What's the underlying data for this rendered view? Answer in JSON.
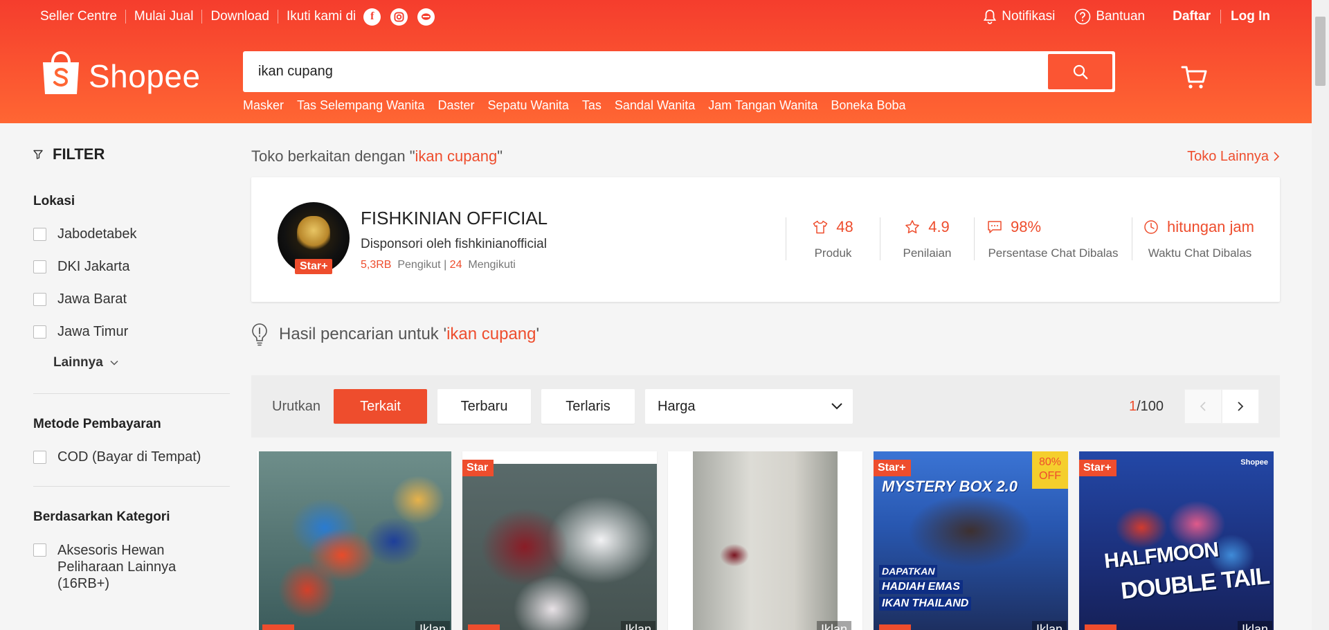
{
  "topnav": {
    "seller_centre": "Seller Centre",
    "mulai_jual": "Mulai Jual",
    "download": "Download",
    "ikuti": "Ikuti kami di",
    "notifikasi": "Notifikasi",
    "bantuan": "Bantuan",
    "daftar": "Daftar",
    "login": "Log In"
  },
  "brand": {
    "name": "Shopee",
    "color": "#ee4d2d"
  },
  "search": {
    "value": "ikan cupang",
    "suggestions": [
      "Masker",
      "Tas Selempang Wanita",
      "Daster",
      "Sepatu Wanita",
      "Tas",
      "Sandal Wanita",
      "Jam Tangan Wanita",
      "Boneka Boba"
    ]
  },
  "sidebar": {
    "filter_title": "FILTER",
    "lokasi": {
      "title": "Lokasi",
      "options": [
        "Jabodetabek",
        "DKI Jakarta",
        "Jawa Barat",
        "Jawa Timur"
      ],
      "more": "Lainnya"
    },
    "pembayaran": {
      "title": "Metode Pembayaran",
      "options": [
        "COD (Bayar di Tempat)"
      ]
    },
    "kategori": {
      "title": "Berdasarkan Kategori",
      "options": [
        "Aksesoris Hewan Peliharaan Lainnya (16RB+)"
      ]
    }
  },
  "shop_section": {
    "prefix": "Toko berkaitan dengan \"",
    "keyword": "ikan cupang",
    "suffix": "\"",
    "more_link": "Toko Lainnya"
  },
  "shop": {
    "name": "FISHKINIAN OFFICIAL",
    "sponsored": "Disponsori oleh fishkinianofficial",
    "badge": "Star+",
    "followers": "5,3RB",
    "followers_label": "Pengikut",
    "following_sep": " | ",
    "following": "24",
    "following_label": "Mengikuti",
    "stats": [
      {
        "icon": "shirt-icon",
        "value": "48",
        "label": "Produk"
      },
      {
        "icon": "star-icon",
        "value": "4.9",
        "label": "Penilaian"
      },
      {
        "icon": "chat-icon",
        "value": "98%",
        "label": "Persentase Chat Dibalas"
      },
      {
        "icon": "clock-icon",
        "value": "hitungan jam",
        "label": "Waktu Chat Dibalas"
      }
    ]
  },
  "result": {
    "prefix": "Hasil pencarian untuk '",
    "keyword": "ikan cupang",
    "suffix": "'"
  },
  "sort": {
    "label": "Urutkan",
    "options": [
      "Terkait",
      "Terbaru",
      "Terlaris"
    ],
    "active": "Terkait",
    "price": "Harga"
  },
  "pagination": {
    "current": "1",
    "total": "/100"
  },
  "products": [
    {
      "tag": "",
      "iklan": "Iklan",
      "discount": ""
    },
    {
      "tag": "Star",
      "iklan": "Iklan",
      "discount": ""
    },
    {
      "tag": "",
      "iklan": "Iklan",
      "discount": ""
    },
    {
      "tag": "Star+",
      "iklan": "Iklan",
      "discount": "80%\nOFF",
      "text": [
        "MYSTERY BOX 2.0",
        "DAPATKAN",
        "HADIAH EMAS",
        "IKAN THAILAND"
      ]
    },
    {
      "tag": "Star+",
      "iklan": "Iklan",
      "discount": "",
      "text": [
        "HALFMOON",
        "DOUBLE TAIL"
      ],
      "logo": "Shopee"
    }
  ]
}
